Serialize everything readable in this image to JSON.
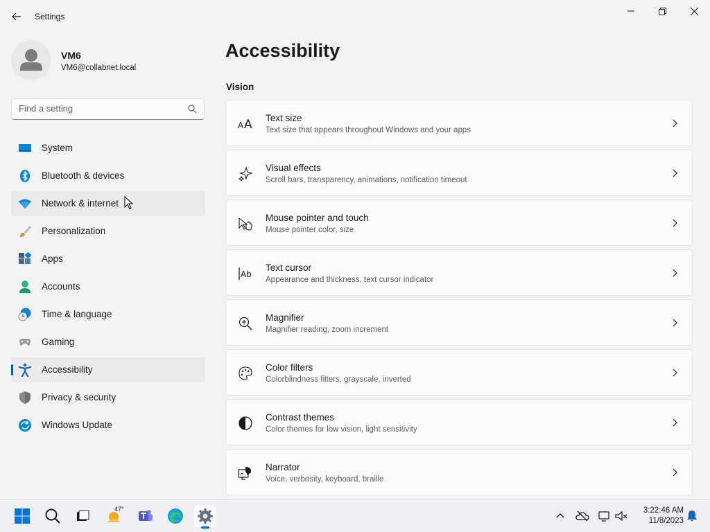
{
  "window": {
    "title": "Settings",
    "back_icon": "back-arrow-icon",
    "minimize_icon": "minimize-icon",
    "restore_icon": "restore-icon",
    "close_icon": "close-icon"
  },
  "profile": {
    "name": "VM6",
    "email": "VM6@collabnet.local"
  },
  "search": {
    "placeholder": "Find a setting",
    "value": ""
  },
  "sidebar": {
    "items": [
      {
        "label": "System",
        "icon": "system-icon",
        "color": "#0078d4"
      },
      {
        "label": "Bluetooth & devices",
        "icon": "bluetooth-icon",
        "color": "#0078d4"
      },
      {
        "label": "Network & internet",
        "icon": "wifi-icon",
        "color": "#0078d4"
      },
      {
        "label": "Personalization",
        "icon": "paintbrush-icon",
        "color": "#e08a3c"
      },
      {
        "label": "Apps",
        "icon": "apps-icon",
        "color": "#4a6c8c"
      },
      {
        "label": "Accounts",
        "icon": "accounts-icon",
        "color": "#2fb28a"
      },
      {
        "label": "Time & language",
        "icon": "time-language-icon",
        "color": "#0078d4"
      },
      {
        "label": "Gaming",
        "icon": "gaming-icon",
        "color": "#8a8a8a"
      },
      {
        "label": "Accessibility",
        "icon": "accessibility-icon",
        "color": "#1565c0"
      },
      {
        "label": "Privacy & security",
        "icon": "shield-icon",
        "color": "#7a7a7a"
      },
      {
        "label": "Windows Update",
        "icon": "windows-update-icon",
        "color": "#0078d4"
      }
    ],
    "selected": "Accessibility",
    "hovered": "Network & internet"
  },
  "main": {
    "title": "Accessibility",
    "section": "Vision",
    "cards": [
      {
        "title": "Text size",
        "subtitle": "Text size that appears throughout Windows and your apps",
        "icon": "text-size-icon"
      },
      {
        "title": "Visual effects",
        "subtitle": "Scroll bars, transparency, animations, notification timeout",
        "icon": "visual-effects-icon"
      },
      {
        "title": "Mouse pointer and touch",
        "subtitle": "Mouse pointer color, size",
        "icon": "mouse-pointer-icon"
      },
      {
        "title": "Text cursor",
        "subtitle": "Appearance and thickness, text cursor indicator",
        "icon": "text-cursor-icon"
      },
      {
        "title": "Magnifier",
        "subtitle": "Magnifier reading, zoom increment",
        "icon": "magnifier-icon"
      },
      {
        "title": "Color filters",
        "subtitle": "Colorblindness filters, grayscale, inverted",
        "icon": "color-filters-icon"
      },
      {
        "title": "Contrast themes",
        "subtitle": "Color themes for low vision, light sensitivity",
        "icon": "contrast-themes-icon"
      },
      {
        "title": "Narrator",
        "subtitle": "Voice, verbosity, keyboard, braille",
        "icon": "narrator-icon"
      }
    ]
  },
  "taskbar": {
    "apps": [
      "start-icon",
      "search-icon",
      "task-view-icon",
      "weather-icon",
      "teams-icon",
      "edge-icon",
      "settings-icon"
    ],
    "weather_temp": "47°",
    "time": "3:22:46 AM",
    "date": "11/8/2023",
    "tray": [
      "chevron-up-icon",
      "onedrive-icon",
      "network-icon",
      "volume-icon",
      "notification-bell-icon"
    ]
  },
  "colors": {
    "accent": "#005fb8",
    "background": "#f3f3f3",
    "card": "#fbfbfb"
  }
}
